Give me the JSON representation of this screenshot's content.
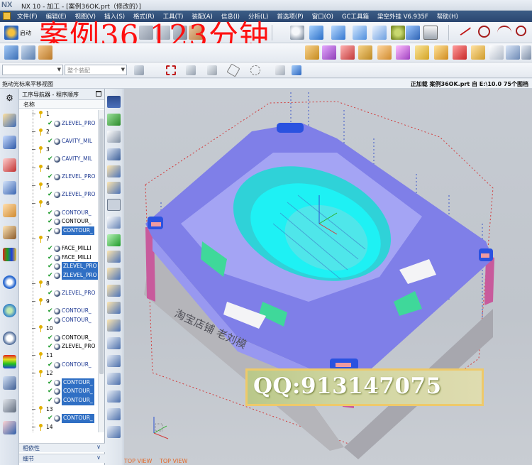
{
  "window": {
    "logo": "NX",
    "title": "NX 10 - 加工 - [案例36OK.prt（修改的）]"
  },
  "menu": [
    "文件(F)",
    "编辑(E)",
    "视图(V)",
    "插入(S)",
    "格式(R)",
    "工具(T)",
    "装配(A)",
    "信息(I)",
    "分析(L)",
    "首选项(P)",
    "窗口(O)",
    "GC工具箱",
    "梁空外挂 V6.935F",
    "帮助(H)"
  ],
  "toolbar": {
    "start_label": "启动",
    "overlay_title": "案例36  123分钟",
    "selection_filter": "",
    "assembly_scope": "整个装配"
  },
  "status": {
    "left": "拖动光标来平移视图",
    "right": "正加载 案例36OK.prt 自 E:\\10.0  75个图档"
  },
  "navigator": {
    "title": "工序导航器 - 程序顺序",
    "column": "名称",
    "rows": [
      {
        "kind": "group",
        "text": "1",
        "top": false
      },
      {
        "kind": "op",
        "text": "ZLEVEL_PRO",
        "sel": false
      },
      {
        "kind": "group",
        "text": "2"
      },
      {
        "kind": "op",
        "text": "CAVITY_MIL",
        "sel": false
      },
      {
        "kind": "group",
        "text": "3"
      },
      {
        "kind": "op",
        "text": "CAVITY_MIL",
        "sel": false
      },
      {
        "kind": "group",
        "text": "4"
      },
      {
        "kind": "op",
        "text": "ZLEVEL_PRO",
        "sel": false
      },
      {
        "kind": "group",
        "text": "5"
      },
      {
        "kind": "op",
        "text": "ZLEVEL_PRO",
        "sel": false
      },
      {
        "kind": "group",
        "text": "6"
      },
      {
        "kind": "op",
        "text": "CONTOUR_",
        "sel": false
      },
      {
        "kind": "op",
        "text": "CONTOUR_",
        "sel": false,
        "black": true
      },
      {
        "kind": "op",
        "text": "CONTOUR_",
        "sel": true
      },
      {
        "kind": "group",
        "text": "7"
      },
      {
        "kind": "op",
        "text": "FACE_MILLI",
        "sel": false,
        "black": true
      },
      {
        "kind": "op",
        "text": "FACE_MILLI",
        "sel": false,
        "black": true
      },
      {
        "kind": "op",
        "text": "ZLEVEL_PRO",
        "sel": true
      },
      {
        "kind": "op",
        "text": "ZLEVEL_PRO",
        "sel": true
      },
      {
        "kind": "group",
        "text": "8"
      },
      {
        "kind": "op",
        "text": "ZLEVEL_PRO",
        "sel": false
      },
      {
        "kind": "group",
        "text": "9"
      },
      {
        "kind": "op",
        "text": "CONTOUR_",
        "sel": false
      },
      {
        "kind": "op",
        "text": "CONTOUR_",
        "sel": false
      },
      {
        "kind": "group",
        "text": "10"
      },
      {
        "kind": "op",
        "text": "CONTOUR_",
        "sel": false,
        "black": true
      },
      {
        "kind": "op",
        "text": "ZLEVEL_PRO",
        "sel": false,
        "black": true
      },
      {
        "kind": "group",
        "text": "11"
      },
      {
        "kind": "op",
        "text": "CONTOUR_",
        "sel": false
      },
      {
        "kind": "group",
        "text": "12"
      },
      {
        "kind": "op",
        "text": "CONTOUR_",
        "sel": true
      },
      {
        "kind": "op",
        "text": "CONTOUR_",
        "sel": true
      },
      {
        "kind": "op",
        "text": "CONTOUR_",
        "sel": true
      },
      {
        "kind": "group",
        "text": "13"
      },
      {
        "kind": "op",
        "text": "CONTOUR_",
        "sel": true
      },
      {
        "kind": "group",
        "text": "14"
      }
    ],
    "panels": [
      "相依性",
      "细节"
    ]
  },
  "graphics": {
    "engraving": "淘宝店铺 老刘模",
    "qq": "QQ:913147075",
    "view_labels": [
      "TOP VIEW",
      "TOP VIEW"
    ]
  }
}
